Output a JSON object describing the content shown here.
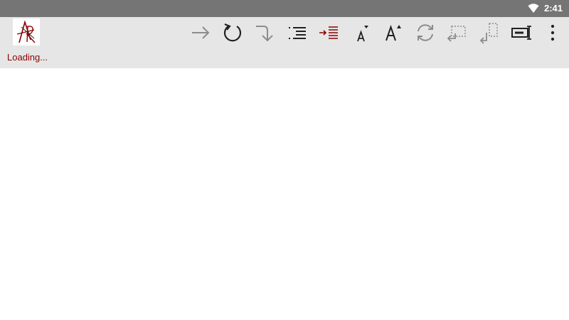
{
  "status_bar": {
    "time": "2:41",
    "icons": [
      "wifi-icon"
    ]
  },
  "toolbar": {
    "loading_text": "Loading...",
    "logo": "app-logo-icon",
    "buttons": [
      {
        "name": "forward-arrow-icon"
      },
      {
        "name": "reload-icon"
      },
      {
        "name": "redirect-down-icon"
      },
      {
        "name": "list-outline-icon"
      },
      {
        "name": "indent-list-icon"
      },
      {
        "name": "font-decrease-icon"
      },
      {
        "name": "font-increase-icon"
      },
      {
        "name": "refresh-icon"
      },
      {
        "name": "copy-back-icon"
      },
      {
        "name": "copy-down-icon"
      },
      {
        "name": "text-cursor-icon"
      },
      {
        "name": "more-options-icon"
      }
    ]
  },
  "colors": {
    "status_bar": "#757575",
    "toolbar": "#e6e6e6",
    "accent": "#8b0000",
    "icon_dark": "#212121",
    "icon_gray": "#8c8c8c"
  }
}
